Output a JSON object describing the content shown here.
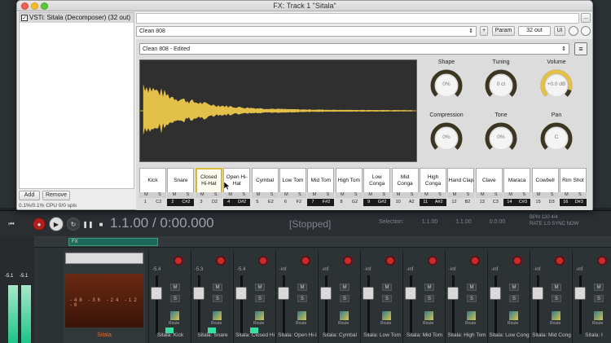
{
  "window": {
    "title": "FX: Track 1 \"Sitala\"",
    "fx_item": "VSTi: Sitala (Decomposer) (32 out)",
    "add_label": "Add",
    "remove_label": "Remove",
    "cpu": "0.1%/0.1% CPU 0/0 spls"
  },
  "header": {
    "preset": "Clean 808",
    "plus_label": "+",
    "param_label": "Param",
    "out_label": "32 out",
    "ui_label": "UI",
    "more_label": "..."
  },
  "plugin": {
    "kit": "Clean 808 - Edited",
    "menu_glyph": "≡",
    "accent": "#e3c04a",
    "knobs": [
      {
        "title": "Shape",
        "value": "0%",
        "level": 0
      },
      {
        "title": "Tuning",
        "value": "0 ct",
        "level": 0
      },
      {
        "title": "Volume",
        "value": "+0.0 dB",
        "level": 0.9
      },
      {
        "title": "Compression",
        "value": "0%",
        "level": 0
      },
      {
        "title": "Tone",
        "value": "0%",
        "level": 0
      },
      {
        "title": "Pan",
        "value": "C",
        "level": 0
      }
    ],
    "pads": [
      {
        "name": "Kick",
        "num": "1",
        "note": "C2",
        "dark": false,
        "sel": false
      },
      {
        "name": "Snare",
        "num": "2",
        "note": "C#2",
        "dark": true,
        "sel": false
      },
      {
        "name": "Closed Hi-Hat",
        "num": "3",
        "note": "D2",
        "dark": false,
        "sel": true
      },
      {
        "name": "Open Hi-Hat",
        "num": "4",
        "note": "D#2",
        "dark": true,
        "sel": false
      },
      {
        "name": "Cymbal",
        "num": "5",
        "note": "E2",
        "dark": false,
        "sel": false
      },
      {
        "name": "Low Tom",
        "num": "6",
        "note": "F2",
        "dark": false,
        "sel": false
      },
      {
        "name": "Mid Tom",
        "num": "7",
        "note": "F#2",
        "dark": true,
        "sel": false
      },
      {
        "name": "High Tom",
        "num": "8",
        "note": "G2",
        "dark": false,
        "sel": false
      },
      {
        "name": "Low Conga",
        "num": "9",
        "note": "G#2",
        "dark": true,
        "sel": false
      },
      {
        "name": "Mid Conga",
        "num": "10",
        "note": "A2",
        "dark": false,
        "sel": false
      },
      {
        "name": "High Conga",
        "num": "11",
        "note": "A#2",
        "dark": true,
        "sel": false
      },
      {
        "name": "Hand Clap",
        "num": "12",
        "note": "B2",
        "dark": false,
        "sel": false
      },
      {
        "name": "Clave",
        "num": "13",
        "note": "C3",
        "dark": false,
        "sel": false
      },
      {
        "name": "Maraca",
        "num": "14",
        "note": "C#3",
        "dark": true,
        "sel": false
      },
      {
        "name": "Cowbell",
        "num": "15",
        "note": "D3",
        "dark": false,
        "sel": false
      },
      {
        "name": "Rim Shot",
        "num": "16",
        "note": "D#3",
        "dark": true,
        "sel": false
      }
    ],
    "m_label": "M",
    "s_label": "S"
  },
  "transport": {
    "time": "1.1.00 / 0:00.000",
    "status": "[Stopped]",
    "selection_label": "Selection:",
    "sel_start": "1.1.00",
    "sel_end": "1.1.00",
    "sel_len": "0.0.00",
    "bpm_label": "BPM",
    "bpm": "120",
    "sig": "4/4",
    "rate_label": "RATE",
    "rate": "1.0",
    "sync_label": "SYNC",
    "sync_mode": "NOW"
  },
  "mixer": {
    "master_name": "Sitala",
    "master_scale": "-48 -36 -24 -12 -6",
    "master_db_left": "-5.1",
    "master_db_right": "-5.1",
    "fx_label": "FX",
    "in_label": "in",
    "route_label": "Route",
    "s_label": "S",
    "mute_label": "M",
    "strips": [
      {
        "name": "Sitala: Kick",
        "db": "-5.4"
      },
      {
        "name": "Sitala: Snare",
        "db": "-5.3"
      },
      {
        "name": "Sitala: Closed Hi",
        "db": "-5.4"
      },
      {
        "name": "Sitala: Open Hi-I",
        "db": "-inf"
      },
      {
        "name": "Sitala: Cymbal",
        "db": "-inf"
      },
      {
        "name": "Sitala: Low Tom",
        "db": "-inf"
      },
      {
        "name": "Sitala: Mid Tom",
        "db": "-inf"
      },
      {
        "name": "Sitala: High Tom",
        "db": "-inf"
      },
      {
        "name": "Sitala: Low Cong",
        "db": "-inf"
      },
      {
        "name": "Sitala: Mid Cong",
        "db": "-inf"
      },
      {
        "name": "Sitala: I",
        "db": "-inf"
      }
    ]
  }
}
